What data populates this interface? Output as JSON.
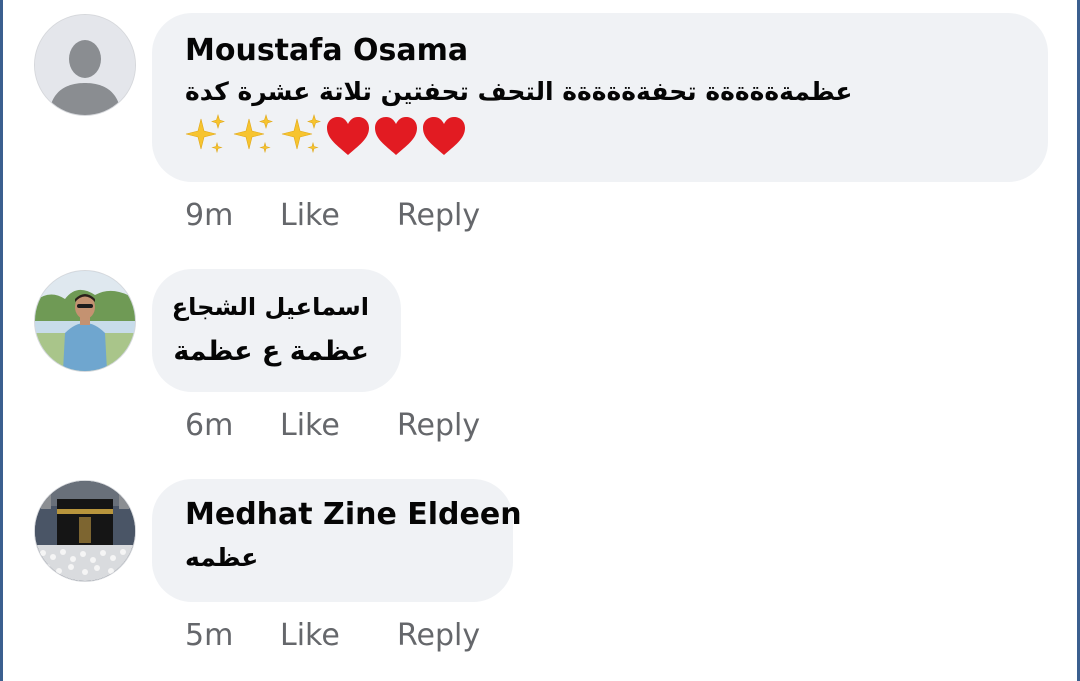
{
  "colors": {
    "bubble_bg": "#f0f2f5",
    "meta_text": "#65676b",
    "heart": "#e21b22",
    "sparkle": "#f7c42f"
  },
  "comments": [
    {
      "author": "Moustafa Osama",
      "text": "عظمةةةةةة تحفةةةةةة التحف تحفتين تلاتة عشرة كدة",
      "emoji": "✨✨✨❤️❤️❤️",
      "avatar_icon": "default-profile-silhouette-icon",
      "time": "9m",
      "like": "Like",
      "reply": "Reply"
    },
    {
      "author": "اسماعيل الشجاع",
      "text": "عظمة ع عظمة",
      "avatar_icon": "user-photo-man-blue-shirt",
      "time": "6m",
      "like": "Like",
      "reply": "Reply"
    },
    {
      "author": "Medhat Zine Eldeen",
      "text": "عظمه",
      "avatar_icon": "kaaba-photo",
      "time": "5m",
      "like": "Like",
      "reply": "Reply"
    }
  ]
}
